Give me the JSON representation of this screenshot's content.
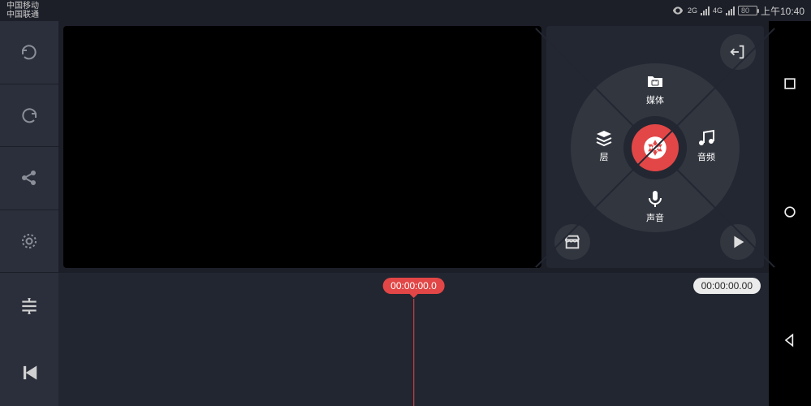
{
  "status": {
    "carrier1": "中国移动",
    "carrier2": "中国联通",
    "net1": "2G",
    "net2": "4G",
    "battery_pct": "80",
    "time": "上午10:40"
  },
  "wheel": {
    "media": "媒体",
    "layer": "层",
    "audio": "音频",
    "voice": "声音"
  },
  "timeline": {
    "playhead": "00:00:00.0",
    "total": "00:00:00.00"
  }
}
